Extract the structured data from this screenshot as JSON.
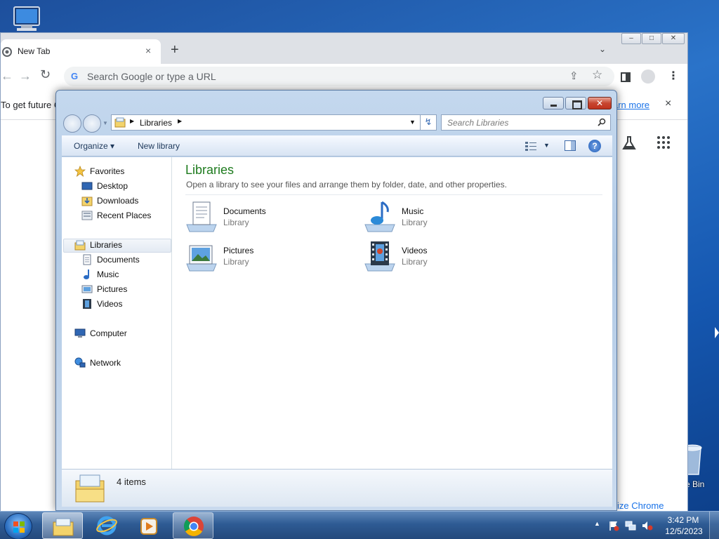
{
  "desktop": {
    "recycle_bin_label": "e Bin"
  },
  "chrome": {
    "tab_title": "New Tab",
    "tab_close": "×",
    "new_tab": "+",
    "tab_search": "⌄",
    "omnibox_placeholder": "Search Google or type a URL",
    "omnibox_g": "G",
    "infobar_text": "To get future C",
    "infobar_link": "arn more",
    "infobar_close": "×",
    "customize_label": "ize Chrome",
    "back_glyph": "←",
    "forward_glyph": "→",
    "reload_glyph": "↻",
    "star_glyph": "☆",
    "share_glyph": "⇪",
    "menu_glyph": "⋮",
    "win_min": "–",
    "win_max": "□",
    "win_close": "✕"
  },
  "explorer": {
    "breadcrumb": "Libraries",
    "search_placeholder": "Search Libraries",
    "toolbar": {
      "organize": "Organize ▾",
      "new_library": "New library",
      "help": "?",
      "views_dd": "▼"
    },
    "nav": {
      "favorites": "Favorites",
      "desktop": "Desktop",
      "downloads": "Downloads",
      "recent_places": "Recent Places",
      "libraries": "Libraries",
      "documents": "Documents",
      "music": "Music",
      "pictures": "Pictures",
      "videos": "Videos",
      "computer": "Computer",
      "network": "Network"
    },
    "heading": "Libraries",
    "subheading": "Open a library to see your files and arrange them by folder, date, and other properties.",
    "libraries": [
      {
        "name": "Documents",
        "type": "Library"
      },
      {
        "name": "Music",
        "type": "Library"
      },
      {
        "name": "Pictures",
        "type": "Library"
      },
      {
        "name": "Videos",
        "type": "Library"
      }
    ],
    "details": "4 items",
    "close_glyph": "✕",
    "refresh_glyph": "↯"
  },
  "taskbar": {
    "time": "3:42 PM",
    "date": "12/5/2023"
  },
  "colors": {
    "heading_green": "#1e7b1e",
    "chrome_link": "#1a73e8",
    "taskbar": "#2e5b94"
  }
}
